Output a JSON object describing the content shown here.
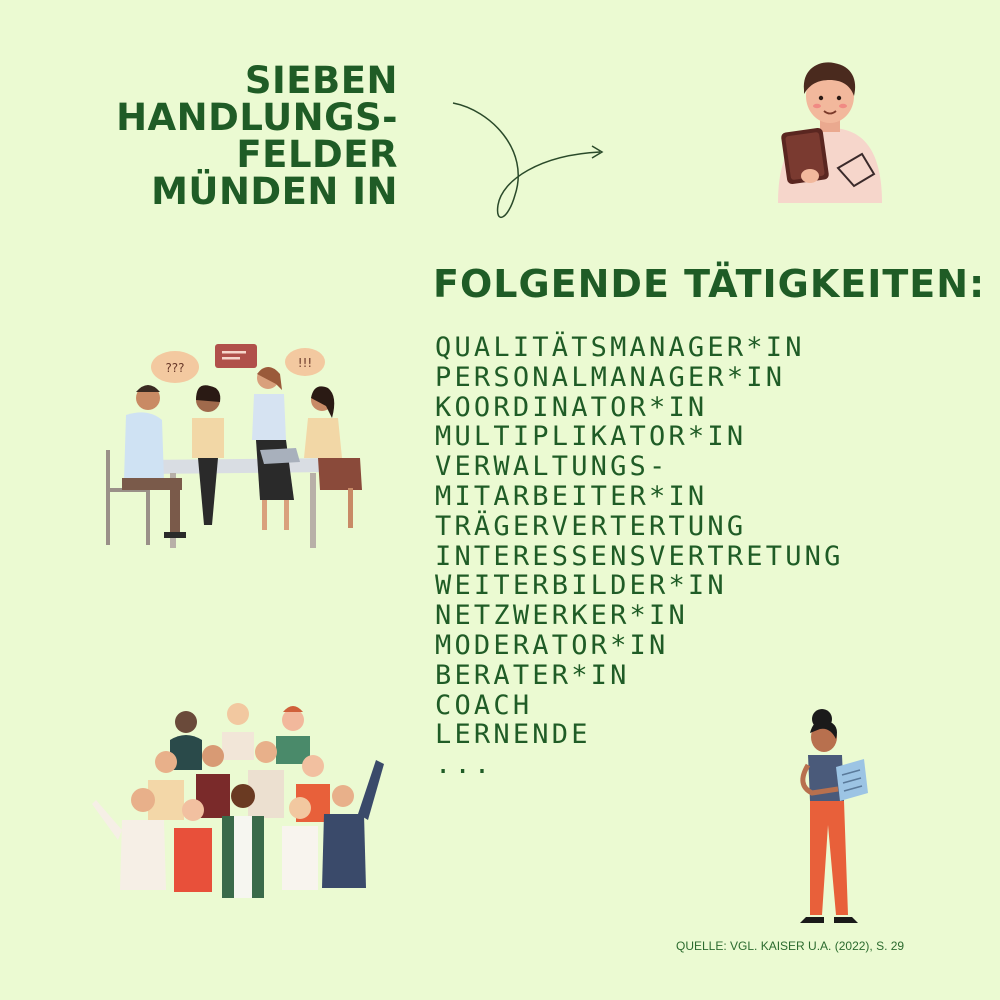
{
  "heading": {
    "lines": [
      "SIEBEN",
      "HANDLUNGS-",
      "FELDER",
      "MÜNDEN IN"
    ]
  },
  "subheading": "FOLGENDE TÄTIGKEITEN:",
  "activities": [
    "QUALITÄTSMANAGER*IN",
    "PERSONALMANAGER*IN",
    "KOORDINATOR*IN",
    "MULTIPLIKATOR*IN",
    "VERWALTUNGS-",
    "MITARBEITER*IN",
    "TRÄGERVERTERTUNG",
    "INTERESSENSVERTRETUNG",
    "WEITERBILDER*IN",
    "NETZWERKER*IN",
    "MODERATOR*IN",
    "BERATER*IN",
    "COACH",
    "LERNENDE",
    "..."
  ],
  "speech_bubbles": [
    "???",
    "!!!"
  ],
  "source": "QUELLE: VGL. KAISER U.A. (2022), S. 29",
  "colors": {
    "background": "#ebfad2",
    "text": "#1f5c26"
  }
}
